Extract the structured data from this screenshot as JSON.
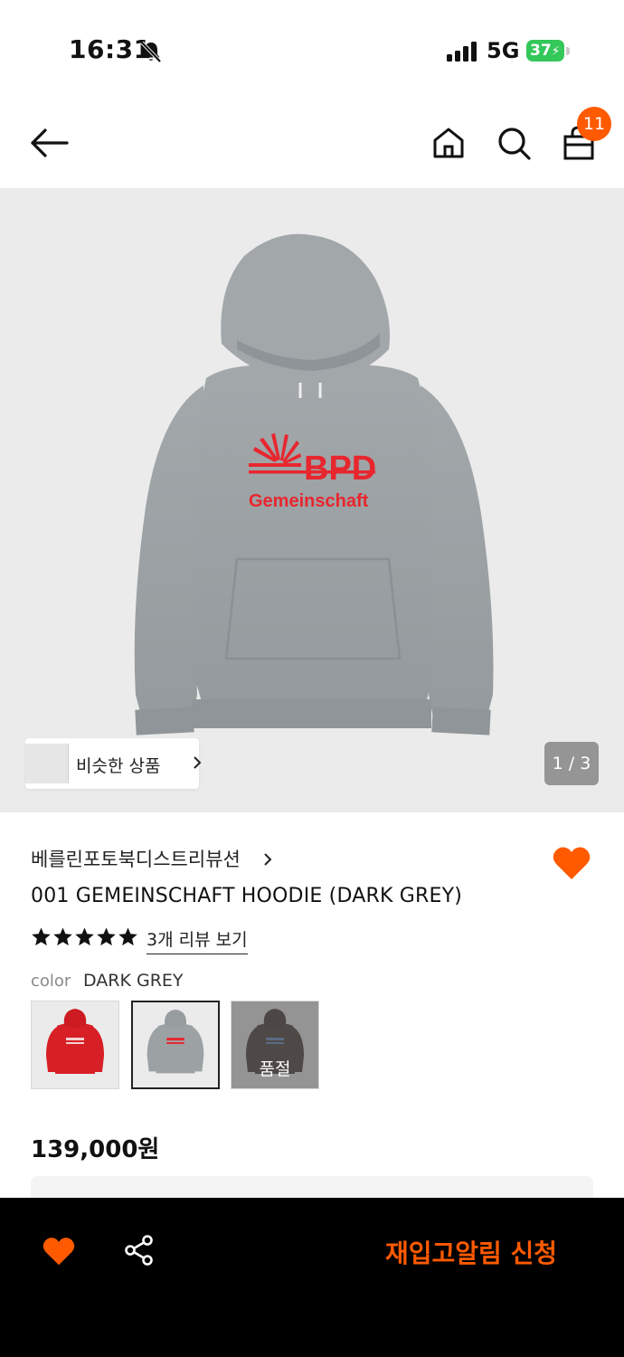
{
  "status_bar": {
    "time": "16:31",
    "network": "5G",
    "battery": "37"
  },
  "header": {
    "cart_count": "11"
  },
  "gallery": {
    "similar_label": "비슷한 상품",
    "page_indicator": "1 / 3"
  },
  "product": {
    "brand": "베를린포토북디스트리뷰션",
    "name": "001 GEMEINSCHAFT HOODIE (DARK GREY)",
    "rating": 5,
    "review_link": "3개 리뷰 보기",
    "color_label": "color",
    "color_value": "DARK GREY",
    "swatches": [
      {
        "color": "red",
        "sold_out": false
      },
      {
        "color": "grey",
        "sold_out": false,
        "selected": true
      },
      {
        "color": "brown",
        "sold_out": true,
        "sold_out_label": "품절"
      }
    ],
    "price": "139,000원",
    "print_text_top": "BPD",
    "print_text_bottom": "Gemeinschaft"
  },
  "bottom_bar": {
    "restock_label": "재입고알림 신청"
  },
  "colors": {
    "accent": "#ff5a00",
    "battery": "#34c759",
    "hoodie_grey": "#9a9fa2",
    "print_red": "#e8262e"
  }
}
